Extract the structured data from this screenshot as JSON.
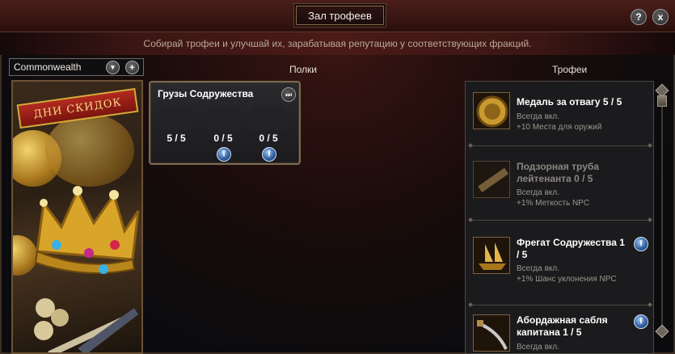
{
  "window": {
    "title": "Зал трофеев",
    "help_label": "?",
    "close_label": "x",
    "subtitle": "Собирай трофеи и улучшай их, зарабатывая репутацию у соответствующих фракций."
  },
  "faction": {
    "selected": "Commonwealth",
    "dropdown_icon": "chevron-down-icon",
    "add_icon": "plus-icon",
    "add_label": "+",
    "dropdown_label": "▼"
  },
  "promo": {
    "banner_text": "ДНИ СКИДОК"
  },
  "shelves": {
    "header": "Полки",
    "items": [
      {
        "title": "Грузы Содружества",
        "slots": [
          {
            "count": "5 / 5",
            "upgradable": false
          },
          {
            "count": "0 / 5",
            "upgradable": true
          },
          {
            "count": "0 / 5",
            "upgradable": true
          }
        ]
      }
    ]
  },
  "trophies": {
    "header": "Трофеи",
    "items": [
      {
        "name": "Медаль за отвагу 5 / 5",
        "status": "Всегда вкл.",
        "bonus": "+10 Места для оружий",
        "dim": false,
        "upgradable": false,
        "icon": "medal-icon"
      },
      {
        "name": "Подзорная труба лейтенанта 0 / 5",
        "status": "Всегда вкл.",
        "bonus": "+1% Меткость NPC",
        "dim": true,
        "upgradable": false,
        "icon": "spyglass-icon"
      },
      {
        "name": "Фрегат Содружества 1 / 5",
        "status": "Всегда вкл.",
        "bonus": "+1% Шанс уклонения NPC",
        "dim": false,
        "upgradable": true,
        "icon": "frigate-icon"
      },
      {
        "name": "Абордажная сабля капитана 1 / 5",
        "status": "Всегда вкл.",
        "bonus": "",
        "dim": false,
        "upgradable": true,
        "icon": "saber-icon"
      }
    ]
  },
  "colors": {
    "accent_red": "#4a1a17",
    "gold_border": "#7b6a52",
    "upgrade_blue": "#2c5c9c"
  }
}
